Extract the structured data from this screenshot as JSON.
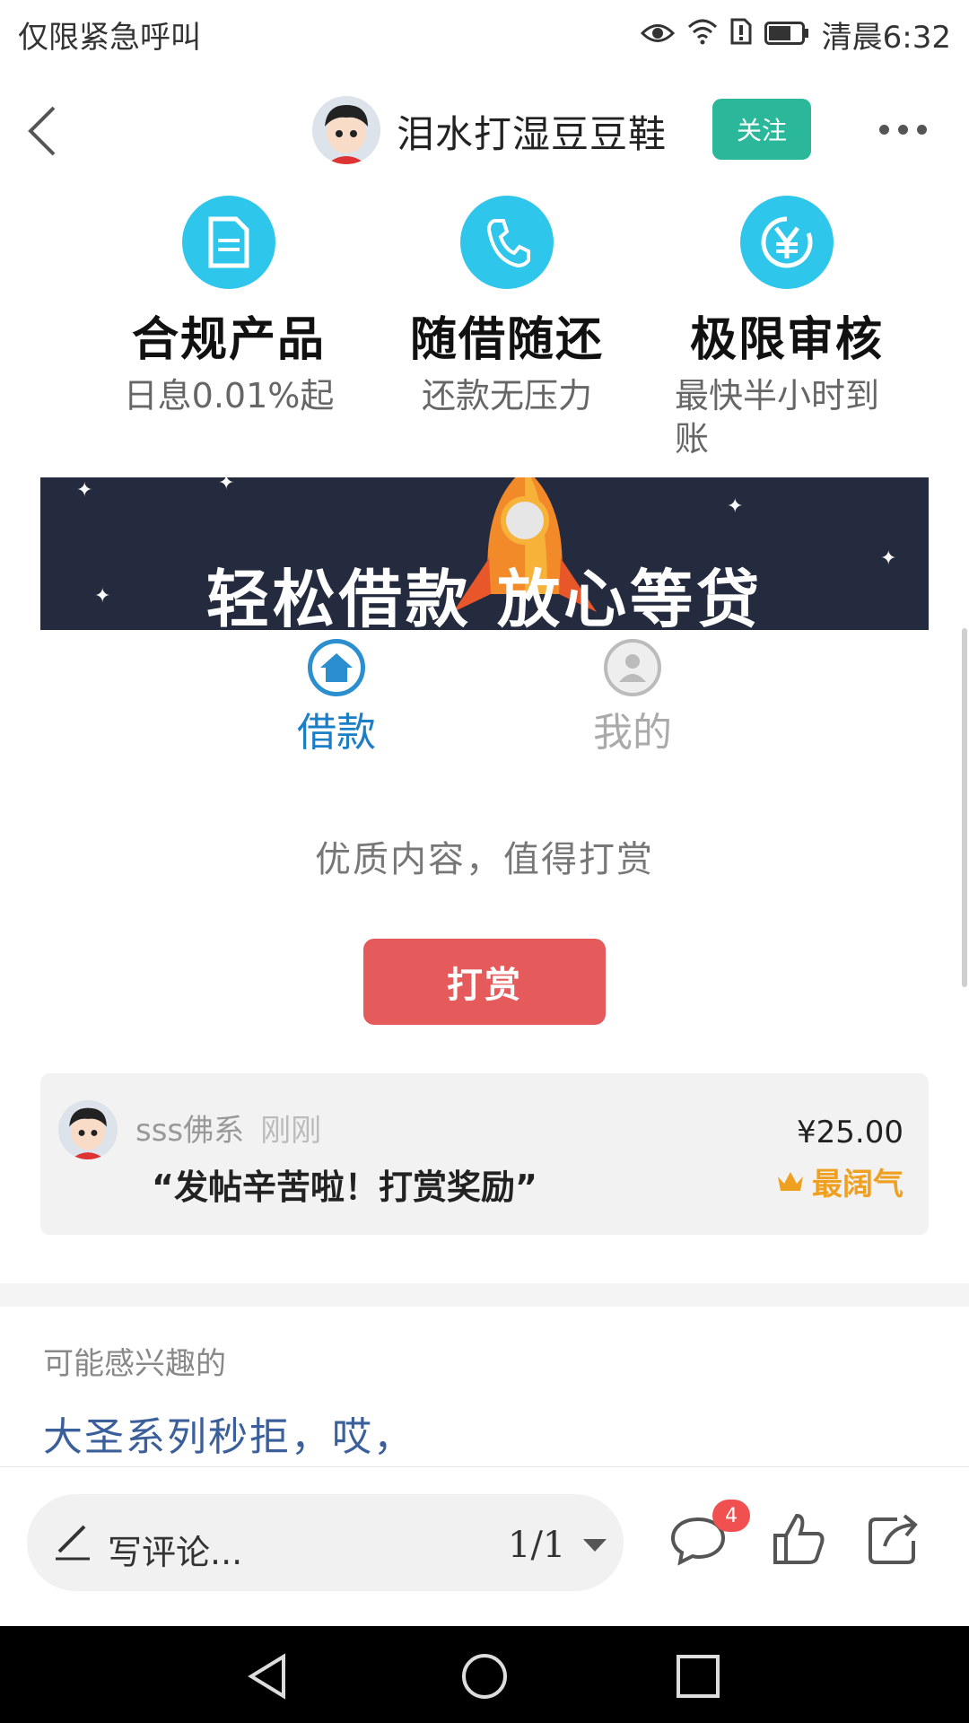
{
  "status_bar": {
    "left_text": "仅限紧急呼叫",
    "time": "清晨6:32"
  },
  "header": {
    "author_name": "泪水打湿豆豆鞋",
    "follow_label": "关注"
  },
  "features": [
    {
      "icon": "document-icon",
      "title": "合规产品",
      "subtitle": "日息0.01%起"
    },
    {
      "icon": "phone-icon",
      "title": "随借随还",
      "subtitle": "还款无压力"
    },
    {
      "icon": "yen-icon",
      "title": "极限审核",
      "subtitle": "最快半小时到账"
    }
  ],
  "banner": {
    "text": "轻松借款 放心等贷"
  },
  "tabs": [
    {
      "label": "借款",
      "icon": "home-icon",
      "active": true
    },
    {
      "label": "我的",
      "icon": "user-icon",
      "active": false
    }
  ],
  "reward": {
    "prompt": "优质内容，值得打赏",
    "button_label": "打赏",
    "record": {
      "user": "sss佛系",
      "time": "刚刚",
      "message": "“发帖辛苦啦！打赏奖励”",
      "amount": "¥25.00",
      "badge": "最阔气"
    }
  },
  "related": {
    "title": "可能感兴趣的",
    "item": "大圣系列秒拒，哎，"
  },
  "bottom_bar": {
    "comment_placeholder": "写评论...",
    "page_indicator": "1/1",
    "comment_count": "4"
  },
  "colors": {
    "accent_green": "#2bb89a",
    "feature_blue": "#2ec6ea",
    "reward_red": "#e55a5a",
    "badge_gold": "#f0a020",
    "link_blue": "#3b5f9a"
  }
}
